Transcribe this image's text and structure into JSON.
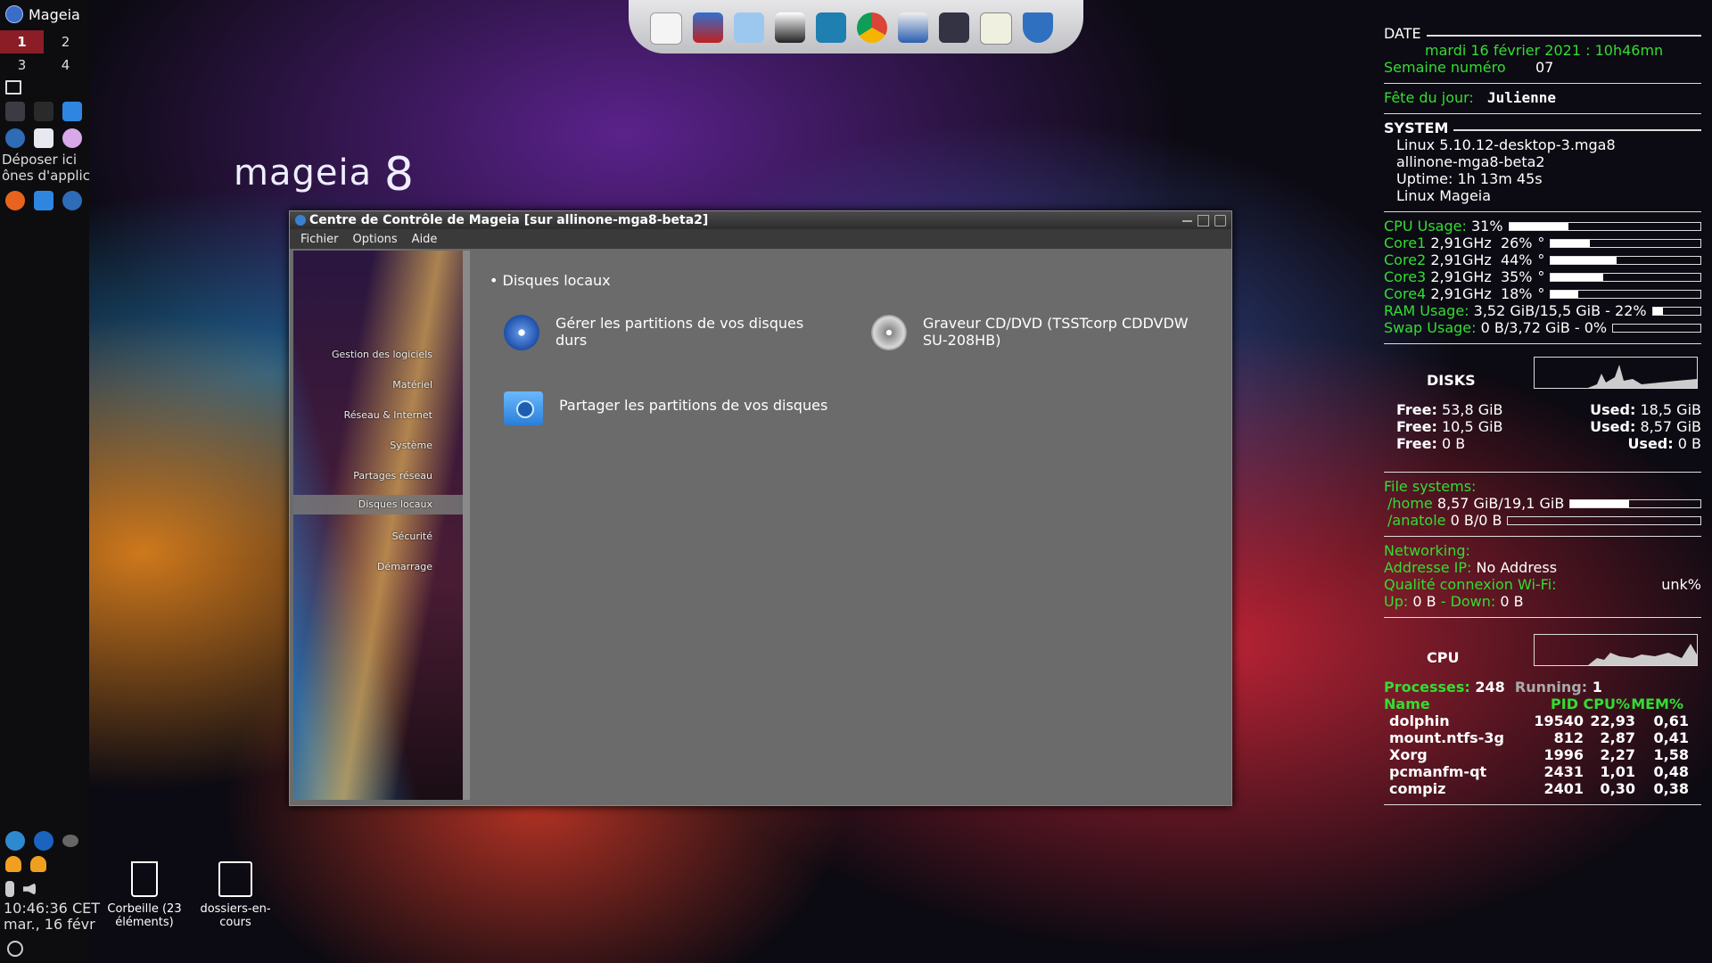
{
  "left_panel": {
    "menu_label": "Mageia",
    "workspaces": [
      "1",
      "2",
      "3",
      "4"
    ],
    "drop_text_1": "Déposer ici",
    "drop_text_2": "ônes d'applic",
    "clock_time": "10:46:36 CET",
    "clock_date": "mar., 16 févr"
  },
  "logo": {
    "text": "mageia",
    "number": "8"
  },
  "window": {
    "title": "Centre de Contrôle de Mageia  [sur allinone-mga8-beta2]",
    "menu": [
      "Fichier",
      "Options",
      "Aide"
    ],
    "sidebar": [
      "Gestion des logiciels",
      "Matériel",
      "Réseau & Internet",
      "Système",
      "Partages réseau",
      "Disques locaux",
      "Sécurité",
      "Démarrage"
    ],
    "active_section": "Disques locaux",
    "section_title": "• Disques locaux",
    "entries": [
      {
        "label_1": "Gérer les partitions de vos disques",
        "label_2": "durs"
      },
      {
        "label_1": "Graveur CD/DVD (TSSTcorp CDDVDW",
        "label_2": "SU-208HB)"
      },
      {
        "label_1": "Partager les partitions de vos disques",
        "label_2": ""
      }
    ]
  },
  "desktop_icons": [
    {
      "label_1": "Corbeille (23",
      "label_2": "éléments)"
    },
    {
      "label_1": "dossiers-en-",
      "label_2": "cours"
    }
  ],
  "conky": {
    "date_label": "DATE",
    "date_value": "mardi 16 février 2021 : 10h46mn",
    "week_label": "Semaine numéro",
    "week_value": "07",
    "feast_label": "Fête du jour:",
    "feast_value": "Julienne",
    "system_label": "SYSTEM",
    "system_lines": [
      "Linux 5.10.12-desktop-3.mga8",
      "allinone-mga8-beta2",
      "Uptime: 1h 13m 45s",
      "Linux Mageia"
    ],
    "cpu_usage_label": "CPU Usage:",
    "cpu_usage_value": "31%",
    "cpu_usage_fraction": 0.31,
    "cores": [
      {
        "name": "Core1",
        "freq": "2,91GHz",
        "pct": "26%",
        "fraction": 0.26
      },
      {
        "name": "Core2",
        "freq": "2,91GHz",
        "pct": "44%",
        "fraction": 0.44
      },
      {
        "name": "Core3",
        "freq": "2,91GHz",
        "pct": "35%",
        "fraction": 0.35
      },
      {
        "name": "Core4",
        "freq": "2,91GHz",
        "pct": "18%",
        "fraction": 0.18
      }
    ],
    "ram_label": "RAM Usage:",
    "ram_value": "3,52 GiB/15,5 GiB - 22%",
    "ram_fraction": 0.22,
    "swap_label": "Swap Usage:",
    "swap_value": "0 B/3,72 GiB - 0%",
    "swap_fraction": 0,
    "disks_label": "DISKS",
    "disks": [
      {
        "free_label": "Free:",
        "free": "53,8 GiB",
        "used_label": "Used:",
        "used": "18,5 GiB"
      },
      {
        "free_label": "Free:",
        "free": "10,5 GiB",
        "used_label": "Used:",
        "used": "8,57 GiB"
      },
      {
        "free_label": "Free:",
        "free": "0 B",
        "used_label": "Used:",
        "used": "0 B"
      }
    ],
    "fs_label": "File systems:",
    "filesystems": [
      {
        "mount": "/home",
        "value": "8,57 GiB/19,1 GiB",
        "fraction": 0.45
      },
      {
        "mount": "/anatole",
        "value": "0 B/0 B",
        "fraction": 0
      }
    ],
    "net_label": "Networking:",
    "ip_label": "Addresse IP:",
    "ip_value": "No Address",
    "wifi_label": "Qualité connexion Wi-Fi:",
    "wifi_value": "unk%",
    "up_label": "Up:",
    "up_value": "0 B",
    "down_label": "- Down:",
    "down_value": "0 B",
    "cpu_graph_label": "CPU",
    "processes_label": "Processes:",
    "processes_value": "248",
    "running_label": "Running:",
    "running_value": "1",
    "proc_headers": [
      "Name",
      "PID",
      "CPU%",
      "MEM%"
    ],
    "procs": [
      [
        "dolphin",
        "19540",
        "22,93",
        "0,61"
      ],
      [
        "mount.ntfs-3g",
        "812",
        "2,87",
        "0,41"
      ],
      [
        "Xorg",
        "1996",
        "2,27",
        "1,58"
      ],
      [
        "pcmanfm-qt",
        "2431",
        "1,01",
        "0,48"
      ],
      [
        "compiz",
        "2401",
        "0,30",
        "0,38"
      ]
    ]
  },
  "colors": {
    "green": "#33dd33",
    "workspace_active": "#8a1d26"
  }
}
